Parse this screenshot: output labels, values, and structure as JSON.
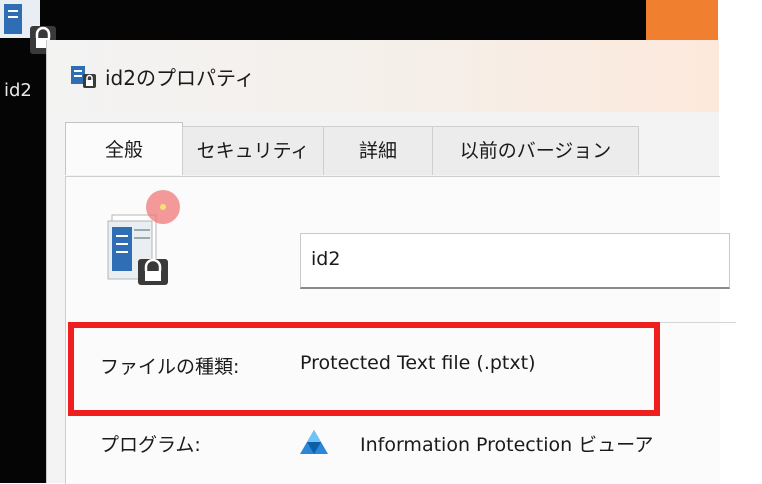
{
  "desktop": {
    "icon_label": "id2"
  },
  "dialog": {
    "title": "id2のプロパティ",
    "tabs": [
      {
        "label": "全般",
        "active": true
      },
      {
        "label": "セキュリティ",
        "active": false
      },
      {
        "label": "詳細",
        "active": false
      },
      {
        "label": "以前のバージョン",
        "active": false
      }
    ],
    "general": {
      "file_name": "id2",
      "file_type_label": "ファイルの種類:",
      "file_type_value": "Protected Text file (.ptxt)",
      "program_label": "プログラム:",
      "program_value": "Information Protection ビューア"
    }
  },
  "colors": {
    "highlight": "#f01f1f",
    "accent_orange": "#f08030"
  },
  "icons": [
    "protected-file-icon",
    "lock-icon",
    "information-protection-icon"
  ]
}
